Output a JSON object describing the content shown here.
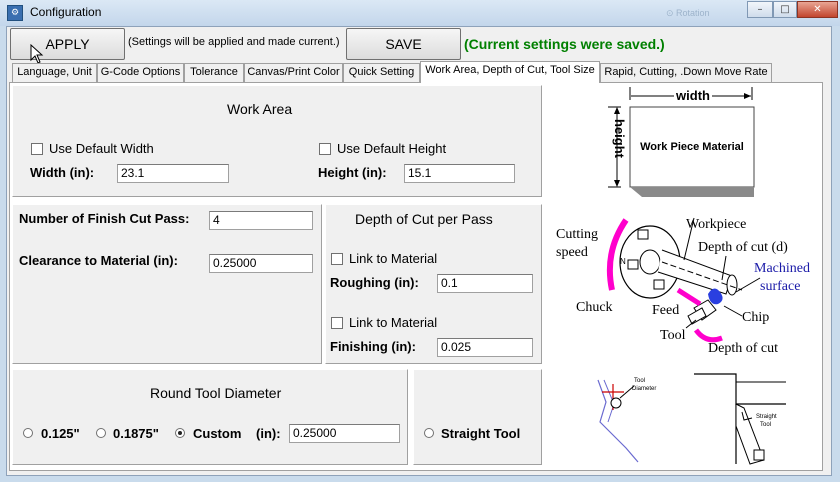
{
  "window": {
    "title": "Configuration",
    "ghost_text": "⊙ Rotation",
    "controls": {
      "minimize": "–",
      "maximize": "□",
      "close": "✕"
    }
  },
  "toolbar": {
    "apply_label": "APPLY",
    "apply_note": "(Settings will be applied and made current.)",
    "save_label": "SAVE",
    "save_note": "(Current settings were saved.)"
  },
  "tabs": [
    {
      "label": "Language, Unit"
    },
    {
      "label": "G-Code Options"
    },
    {
      "label": "Tolerance"
    },
    {
      "label": "Canvas/Print Color"
    },
    {
      "label": "Quick Setting"
    },
    {
      "label": "Work Area, Depth of Cut, Tool Size",
      "active": true
    },
    {
      "label": "Rapid, Cutting, .Down Move Rate"
    }
  ],
  "work_area": {
    "heading": "Work Area",
    "default_width_label": "Use Default Width",
    "default_width_checked": false,
    "width_label": "Width   (in):",
    "width_value": "23.1",
    "default_height_label": "Use Default Height",
    "default_height_checked": false,
    "height_label": "Height (in):",
    "height_value": "15.1"
  },
  "work_area_image": {
    "width_text": "width",
    "height_text": "height",
    "material_text": "Work Piece Material"
  },
  "finish": {
    "passes_label": "Number of Finish Cut Pass:",
    "passes_value": "4",
    "clearance_label": "Clearance to Material  (in):",
    "clearance_value": "0.25000"
  },
  "depth_of_cut": {
    "heading": "Depth of Cut per Pass",
    "link_roughing_label": "Link to Material",
    "link_roughing_checked": false,
    "roughing_label": "Roughing  (in):",
    "roughing_value": "0.1",
    "link_finishing_label": "Link to Material",
    "link_finishing_checked": false,
    "finishing_label": "Finishing  (in):",
    "finishing_value": "0.025"
  },
  "lathe_image": {
    "cutting_speed": "Cutting speed",
    "cutting_speed_l1": "Cutting",
    "cutting_speed_l2": "speed",
    "workpiece": "Workpiece",
    "depth_of_cut_d": "Depth of cut (d)",
    "machined_surface": "Machined surface",
    "machined_l1": "Machined",
    "machined_l2": "surface",
    "chuck": "Chuck",
    "feed": "Feed",
    "chip": "Chip",
    "tool": "Tool",
    "depth_of_cut": "Depth of cut",
    "jaw_letter": "N",
    "colors": {
      "accent": "#ff00cc",
      "machined": "#1a1aa8",
      "chip": "#2a3fe0"
    }
  },
  "round_tool": {
    "heading": "Round Tool Diameter",
    "options": [
      {
        "label": "0.125\"",
        "selected": false
      },
      {
        "label": "0.1875\"",
        "selected": false
      },
      {
        "label": "Custom",
        "selected": true
      }
    ],
    "custom_unit_label": "(in):",
    "custom_value": "0.25000"
  },
  "straight_tool": {
    "label": "Straight Tool",
    "selected": false
  },
  "tool_image": {
    "diameter_l1": "Tool",
    "diameter_l2": "Diameter",
    "straight_l1": "Straight",
    "straight_l2": "Tool"
  }
}
